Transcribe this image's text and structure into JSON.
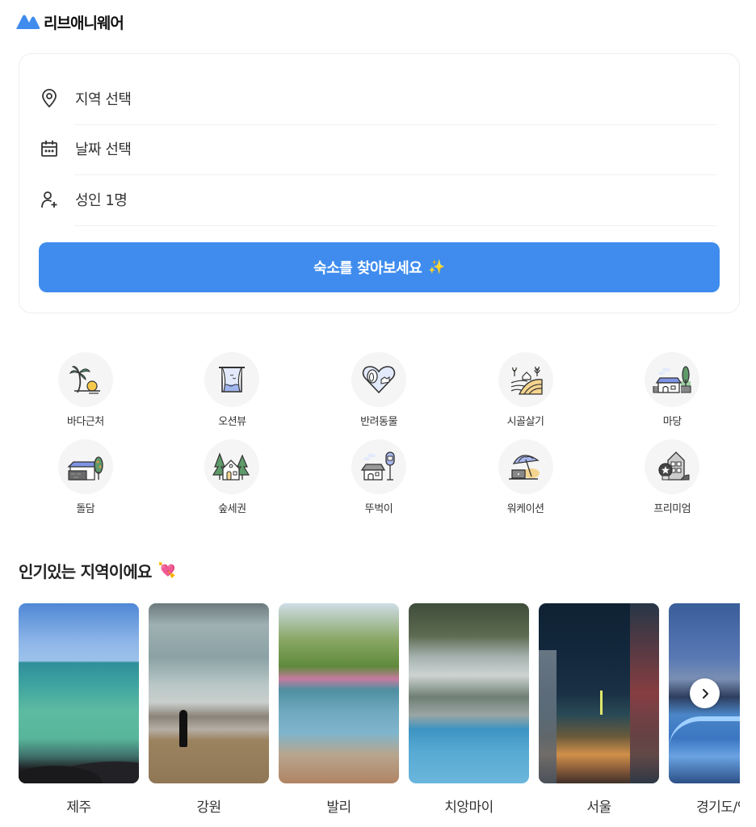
{
  "header": {
    "brand": "리브애니웨어",
    "brand_color": "#3f8cee"
  },
  "search": {
    "rows": [
      {
        "icon": "map-pin-icon",
        "label": "지역 선택"
      },
      {
        "icon": "calendar-icon",
        "label": "날짜 선택"
      },
      {
        "icon": "user-plus-icon",
        "label": "성인 1명"
      }
    ],
    "button_label": "숙소를 찾아보세요",
    "button_emoji": "✨",
    "button_color": "#3f8cee"
  },
  "categories": [
    {
      "icon": "palm-beach-icon",
      "label": "바다근처"
    },
    {
      "icon": "ocean-window-icon",
      "label": "오션뷰"
    },
    {
      "icon": "pet-heart-icon",
      "label": "반려동물"
    },
    {
      "icon": "countryside-icon",
      "label": "시골살기"
    },
    {
      "icon": "yard-house-icon",
      "label": "마당"
    },
    {
      "icon": "stone-wall-icon",
      "label": "돌담"
    },
    {
      "icon": "forest-house-icon",
      "label": "숲세권"
    },
    {
      "icon": "bus-stop-icon",
      "label": "뚜벅이"
    },
    {
      "icon": "workation-icon",
      "label": "워케이션"
    },
    {
      "icon": "premium-building-icon",
      "label": "프리미엄"
    }
  ],
  "popular": {
    "title": "인기있는 지역이에요",
    "emoji": "💘",
    "regions": [
      {
        "name": "제주"
      },
      {
        "name": "강원"
      },
      {
        "name": "발리"
      },
      {
        "name": "치앙마이"
      },
      {
        "name": "서울"
      },
      {
        "name": "경기도/인천"
      }
    ],
    "next_icon": "chevron-right-icon"
  }
}
